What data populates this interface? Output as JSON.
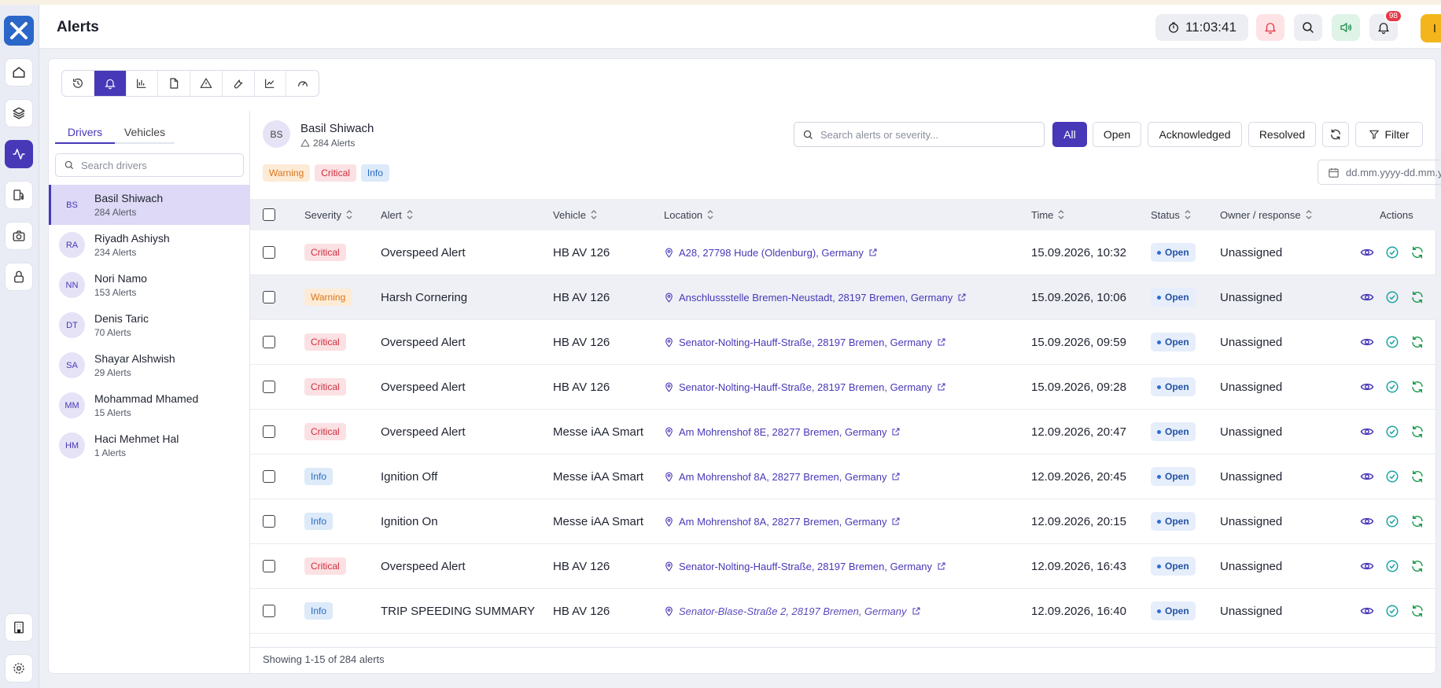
{
  "header": {
    "title": "Alerts",
    "clock": "11:03:41",
    "notification_count": "98",
    "user_initial": "I"
  },
  "colors": {
    "accent": "#4738b8",
    "critical": "#cf2d3d",
    "warning": "#d9761a",
    "info": "#2a6bbf"
  },
  "tabs": {
    "drivers": "Drivers",
    "vehicles": "Vehicles"
  },
  "driver_search": {
    "placeholder": "Search drivers"
  },
  "drivers": [
    {
      "initials": "BS",
      "name": "Basil Shiwach",
      "alerts": "284 Alerts"
    },
    {
      "initials": "RA",
      "name": "Riyadh Ashiysh",
      "alerts": "234 Alerts"
    },
    {
      "initials": "NN",
      "name": "Nori Namo",
      "alerts": "153 Alerts"
    },
    {
      "initials": "DT",
      "name": "Denis Taric",
      "alerts": "70 Alerts"
    },
    {
      "initials": "SA",
      "name": "Shayar Alshwish",
      "alerts": "29 Alerts"
    },
    {
      "initials": "MM",
      "name": "Mohammad Mhamed",
      "alerts": "15 Alerts"
    },
    {
      "initials": "HM",
      "name": "Haci Mehmet Hal",
      "alerts": "1 Alerts"
    }
  ],
  "selected": {
    "initials": "BS",
    "name": "Basil Shiwach",
    "alerts": "284 Alerts"
  },
  "alert_search": {
    "placeholder": "Search alerts or severity..."
  },
  "filters": {
    "all": "All",
    "open": "Open",
    "acknowledged": "Acknowledged",
    "resolved": "Resolved",
    "filter": "Filter"
  },
  "severity_chips": {
    "warning": "Warning",
    "critical": "Critical",
    "info": "Info"
  },
  "date_range": {
    "placeholder": "dd.mm.yyyy-dd.mm.yyyy"
  },
  "columns": {
    "severity": "Severity",
    "alert": "Alert",
    "vehicle": "Vehicle",
    "location": "Location",
    "time": "Time",
    "status": "Status",
    "owner": "Owner / response",
    "actions": "Actions"
  },
  "rows": [
    {
      "severity": "Critical",
      "alert": "Overspeed Alert",
      "vehicle": "HB AV 126",
      "location": "A28, 27798 Hude (Oldenburg), Germany",
      "time": "15.09.2026, 10:32",
      "status": "Open",
      "owner": "Unassigned"
    },
    {
      "severity": "Warning",
      "alert": "Harsh Cornering",
      "vehicle": "HB AV 126",
      "location": "Anschlussstelle Bremen-Neustadt, 28197 Bremen, Germany",
      "time": "15.09.2026, 10:06",
      "status": "Open",
      "owner": "Unassigned"
    },
    {
      "severity": "Critical",
      "alert": "Overspeed Alert",
      "vehicle": "HB AV 126",
      "location": "Senator-Nolting-Hauff-Straße, 28197 Bremen, Germany",
      "time": "15.09.2026, 09:59",
      "status": "Open",
      "owner": "Unassigned"
    },
    {
      "severity": "Critical",
      "alert": "Overspeed Alert",
      "vehicle": "HB AV 126",
      "location": "Senator-Nolting-Hauff-Straße, 28197 Bremen, Germany",
      "time": "15.09.2026, 09:28",
      "status": "Open",
      "owner": "Unassigned"
    },
    {
      "severity": "Critical",
      "alert": "Overspeed Alert",
      "vehicle": "Messe iAA Smart",
      "location": "Am Mohrenshof 8E, 28277 Bremen, Germany",
      "time": "12.09.2026, 20:47",
      "status": "Open",
      "owner": "Unassigned"
    },
    {
      "severity": "Info",
      "alert": "Ignition Off",
      "vehicle": "Messe iAA Smart",
      "location": "Am Mohrenshof 8A, 28277 Bremen, Germany",
      "time": "12.09.2026, 20:45",
      "status": "Open",
      "owner": "Unassigned"
    },
    {
      "severity": "Info",
      "alert": "Ignition On",
      "vehicle": "Messe iAA Smart",
      "location": "Am Mohrenshof 8A, 28277 Bremen, Germany",
      "time": "12.09.2026, 20:15",
      "status": "Open",
      "owner": "Unassigned"
    },
    {
      "severity": "Critical",
      "alert": "Overspeed Alert",
      "vehicle": "HB AV 126",
      "location": "Senator-Nolting-Hauff-Straße, 28197 Bremen, Germany",
      "time": "12.09.2026, 16:43",
      "status": "Open",
      "owner": "Unassigned"
    },
    {
      "severity": "Info",
      "alert": "TRIP SPEEDING SUMMARY",
      "vehicle": "HB AV 126",
      "location": "Senator-Blase-Straße 2, 28197 Bremen, Germany",
      "time": "12.09.2026, 16:40",
      "status": "Open",
      "owner": "Unassigned"
    }
  ],
  "footer": {
    "text": "Showing 1-15 of 284 alerts"
  }
}
